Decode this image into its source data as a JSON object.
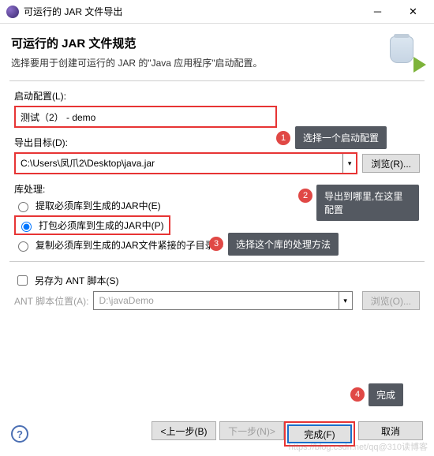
{
  "titlebar": {
    "title": "可运行的 JAR 文件导出"
  },
  "header": {
    "title": "可运行的 JAR 文件规范",
    "sub": "选择要用于创建可运行的 JAR 的\"Java 应用程序\"启动配置。"
  },
  "launch": {
    "label": "启动配置(L):",
    "value": "测试（2） - demo"
  },
  "dest": {
    "label": "导出目标(D):",
    "value": "C:\\Users\\凤爪2\\Desktop\\java.jar",
    "browse": "浏览(R)..."
  },
  "lib": {
    "label": "库处理:",
    "opt1": "提取必须库到生成的JAR中(E)",
    "opt2": "打包必须库到生成的JAR中(P)",
    "opt3": "复制必须库到生成的JAR文件紧接的子目录中"
  },
  "ant": {
    "saveas": "另存为 ANT 脚本(S)",
    "loc_label": "ANT 脚本位置(A):",
    "loc_value": "D:\\javaDemo",
    "browse": "浏览(O)..."
  },
  "buttons": {
    "back": "<上一步(B)",
    "next": "下一步(N)>",
    "finish": "完成(F)",
    "cancel": "取消"
  },
  "annotations": {
    "a1": "选择一个启动配置",
    "a2": "导出到哪里,在这里配置",
    "a3": "选择这个库的处理方法",
    "a4": "完成",
    "n1": "1",
    "n2": "2",
    "n3": "3",
    "n4": "4"
  },
  "watermark": "https://blog.csdn.net/qq@310读博客"
}
